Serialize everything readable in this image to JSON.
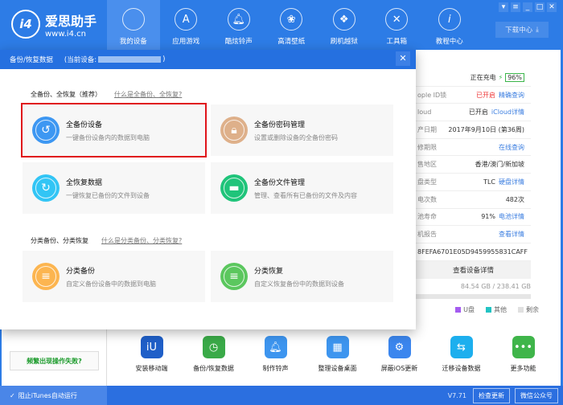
{
  "app": {
    "logo_mark": "i4",
    "name": "爱思助手",
    "url": "www.i4.cn"
  },
  "nav": [
    {
      "label": "我的设备",
      "icon": "apple-icon",
      "active": true
    },
    {
      "label": "应用游戏",
      "icon": "app-store-icon"
    },
    {
      "label": "酷炫铃声",
      "icon": "bell-icon"
    },
    {
      "label": "高清壁纸",
      "icon": "flower-icon"
    },
    {
      "label": "刷机越狱",
      "icon": "dropbox-icon"
    },
    {
      "label": "工具箱",
      "icon": "tools-icon"
    },
    {
      "label": "教程中心",
      "icon": "info-icon"
    }
  ],
  "window_buttons": [
    "skin",
    "menu",
    "minimize",
    "maximize",
    "close"
  ],
  "download_center": "下载中心",
  "modal": {
    "title": "备份/恢复数据",
    "device_prefix": "(当前设备:",
    "device_suffix": ")",
    "section1": {
      "title": "全备份、全恢复（推荐）",
      "help": "什么是全备份、全恢复?"
    },
    "section2": {
      "title": "分类备份、分类恢复",
      "help": "什么是分类备份、分类恢复?"
    },
    "cards": [
      {
        "title": "全备份设备",
        "desc": "一键备份设备内的数据到电脑",
        "color": "#3d97f2",
        "selected": true
      },
      {
        "title": "全备份密码管理",
        "desc": "设置或删除设备的全备份密码",
        "color": "#deb08a"
      },
      {
        "title": "全恢复数据",
        "desc": "一键恢复已备份的文件到设备",
        "color": "#32c5f5"
      },
      {
        "title": "全备份文件管理",
        "desc": "管理、查看所有已备份的文件及内容",
        "color": "#1fc47a"
      },
      {
        "title": "分类备份",
        "desc": "自定义备份设备中的数据到电脑",
        "color": "#fcb550"
      },
      {
        "title": "分类恢复",
        "desc": "自定义恢复备份中的数据到设备",
        "color": "#5bc75e"
      }
    ]
  },
  "device_info": {
    "charging": "正在充电",
    "battery": "96%",
    "rows": [
      {
        "label": "ople ID锁",
        "value": "已开启",
        "value_red": true,
        "link": "精确查询"
      },
      {
        "label": "loud",
        "value": "已开启",
        "link": "iCloud详情"
      },
      {
        "label": "产日期",
        "value": "2017年9月10日 (第36周)"
      },
      {
        "label": "修期限",
        "value": "",
        "link": "在线查询"
      },
      {
        "label": "售地区",
        "value": "香港/澳门/新加坡"
      },
      {
        "label": "盘类型",
        "value": "TLC",
        "link": "硬盘详情"
      },
      {
        "label": "电次数",
        "value": "482次"
      },
      {
        "label": "池寿命",
        "value": "91%",
        "link": "电池详情"
      },
      {
        "label": "机报告",
        "value": "",
        "link": "查看详情"
      }
    ],
    "serial": "8FEFA6701E05D9459955831CAFF",
    "details_button": "查看设备详情",
    "storage": "84.54 GB / 238.41 GB",
    "legend": [
      {
        "label": "U盘",
        "color": "#a45cf0"
      },
      {
        "label": "其他",
        "color": "#22c3c3"
      },
      {
        "label": "剩余",
        "color": "#e0e0e0"
      }
    ]
  },
  "fail_button": "频繁出现操作失败?",
  "tools": [
    {
      "label": "安装移动端",
      "color": "#1f5fc8",
      "icon": "i4-icon"
    },
    {
      "label": "备份/恢复数据",
      "color": "#3aaa48",
      "icon": "clock-icon"
    },
    {
      "label": "制作铃声",
      "color": "#3d95ef",
      "icon": "bell-icon"
    },
    {
      "label": "整理设备桌面",
      "color": "#3d95ef",
      "icon": "grid-icon"
    },
    {
      "label": "屏蔽iOS更新",
      "color": "#3b86ee",
      "icon": "gear-icon"
    },
    {
      "label": "迁移设备数据",
      "color": "#1dafee",
      "icon": "phones-icon"
    },
    {
      "label": "更多功能",
      "color": "#3fb54a",
      "icon": "more-icon"
    }
  ],
  "status": {
    "itunes": "阻止iTunes自动运行",
    "version": "V7.71",
    "check_update": "检查更新",
    "wechat": "微信公众号"
  }
}
